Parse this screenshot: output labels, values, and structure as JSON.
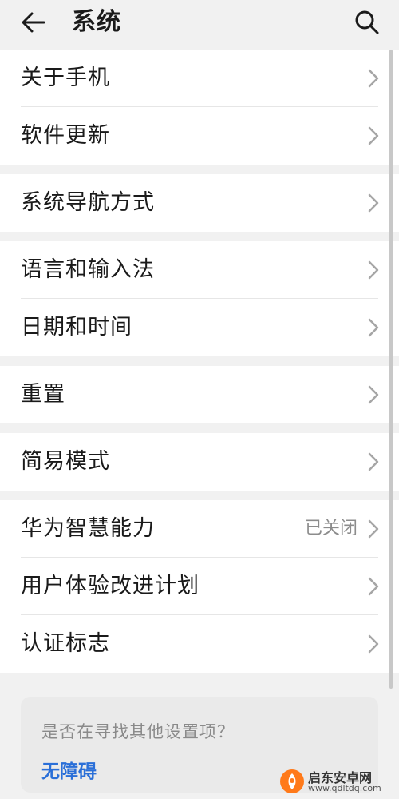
{
  "header": {
    "title": "系统",
    "back_icon": "arrow-left-icon",
    "search_icon": "search-icon"
  },
  "groups": [
    {
      "items": [
        {
          "label": "关于手机"
        },
        {
          "label": "软件更新"
        }
      ]
    },
    {
      "items": [
        {
          "label": "系统导航方式"
        }
      ]
    },
    {
      "items": [
        {
          "label": "语言和输入法"
        },
        {
          "label": "日期和时间"
        }
      ]
    },
    {
      "items": [
        {
          "label": "重置"
        }
      ]
    },
    {
      "items": [
        {
          "label": "简易模式"
        }
      ]
    },
    {
      "items": [
        {
          "label": "华为智慧能力",
          "value": "已关闭"
        },
        {
          "label": "用户体验改进计划"
        },
        {
          "label": "认证标志"
        }
      ]
    }
  ],
  "hint": {
    "text": "是否在寻找其他设置项？",
    "link": "无障碍"
  },
  "watermark": {
    "title": "启东安卓网",
    "url": "www.qdltdq.com"
  },
  "colors": {
    "background": "#f1f1f1",
    "card": "#ffffff",
    "link": "#2a6fd8",
    "muted": "#8c8c8c"
  }
}
